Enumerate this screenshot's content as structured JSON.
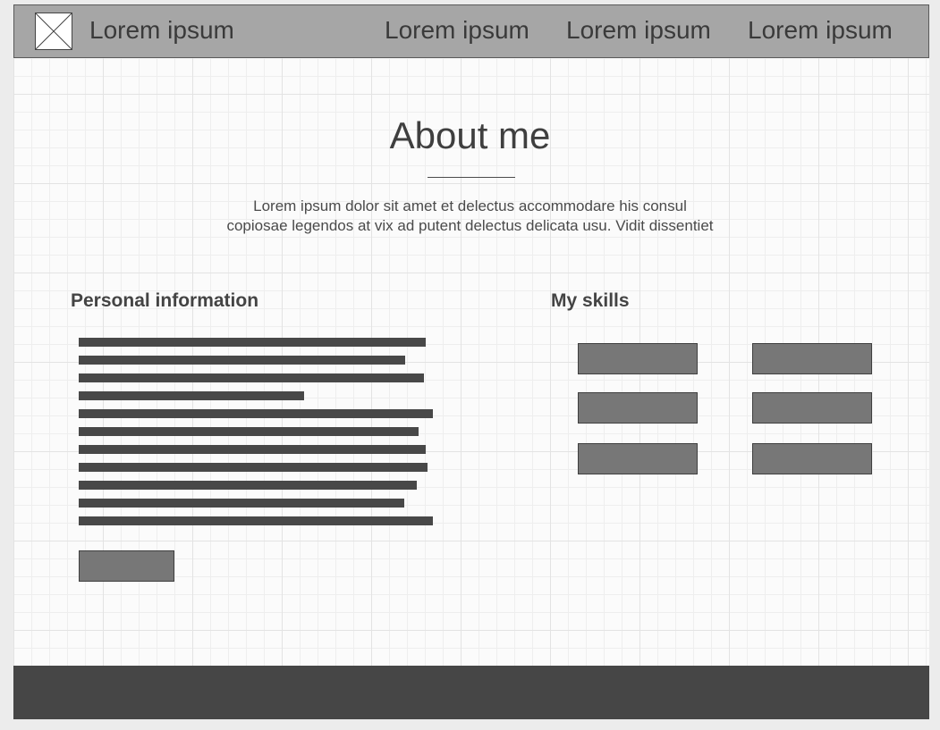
{
  "header": {
    "logo_icon": "image-placeholder-icon",
    "brand": "Lorem ipsum",
    "nav": [
      "Lorem ipsum",
      "Lorem ipsum",
      "Lorem ipsum"
    ]
  },
  "main": {
    "title": "About me",
    "intro_lines": [
      "Lorem ipsum dolor sit amet et delectus accommodare his consul",
      "copiosae legendos at vix ad putent delectus delicata usu. Vidit dissentiet"
    ]
  },
  "personal": {
    "heading": "Personal information"
  },
  "skills": {
    "heading": "My skills"
  },
  "colors": {
    "navbar": "#a6a6a6",
    "footer": "#464646",
    "button": "#777777",
    "text_bar": "#484848"
  }
}
